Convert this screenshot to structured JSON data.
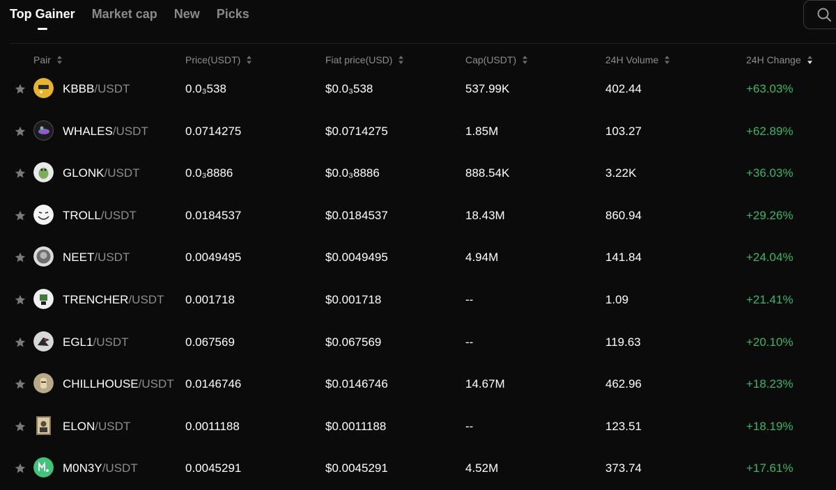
{
  "tabs": [
    {
      "label": "Top Gainer",
      "active": true
    },
    {
      "label": "Market cap",
      "active": false
    },
    {
      "label": "New",
      "active": false
    },
    {
      "label": "Picks",
      "active": false
    }
  ],
  "table": {
    "columns": [
      "Pair",
      "Price(USDT)",
      "Fiat price(USD)",
      "Cap(USDT)",
      "24H Volume",
      "24H Change"
    ],
    "sorted_column": "24H Change",
    "sort_direction": "desc",
    "positive_color": "#35b86a",
    "rows": [
      {
        "base": "KBBB",
        "quote": "/USDT",
        "price": "0.0₃538",
        "fiat": "$0.0₃538",
        "cap": "537.99K",
        "volume": "402.44",
        "change": "+63.03%",
        "icon": "kbbb-coin-icon"
      },
      {
        "base": "WHALES",
        "quote": "/USDT",
        "price": "0.0714275",
        "fiat": "$0.0714275",
        "cap": "1.85M",
        "volume": "103.27",
        "change": "+62.89%",
        "icon": "whales-coin-icon"
      },
      {
        "base": "GLONK",
        "quote": "/USDT",
        "price": "0.0₃8886",
        "fiat": "$0.0₃8886",
        "cap": "888.54K",
        "volume": "3.22K",
        "change": "+36.03%",
        "icon": "glonk-coin-icon"
      },
      {
        "base": "TROLL",
        "quote": "/USDT",
        "price": "0.0184537",
        "fiat": "$0.0184537",
        "cap": "18.43M",
        "volume": "860.94",
        "change": "+29.26%",
        "icon": "troll-coin-icon"
      },
      {
        "base": "NEET",
        "quote": "/USDT",
        "price": "0.0049495",
        "fiat": "$0.0049495",
        "cap": "4.94M",
        "volume": "141.84",
        "change": "+24.04%",
        "icon": "neet-coin-icon"
      },
      {
        "base": "TRENCHER",
        "quote": "/USDT",
        "price": "0.001718",
        "fiat": "$0.001718",
        "cap": "--",
        "volume": "1.09",
        "change": "+21.41%",
        "icon": "trencher-coin-icon"
      },
      {
        "base": "EGL1",
        "quote": "/USDT",
        "price": "0.067569",
        "fiat": "$0.067569",
        "cap": "--",
        "volume": "119.63",
        "change": "+20.10%",
        "icon": "egl1-coin-icon"
      },
      {
        "base": "CHILLHOUSE",
        "quote": "/USDT",
        "price": "0.0146746",
        "fiat": "$0.0146746",
        "cap": "14.67M",
        "volume": "462.96",
        "change": "+18.23%",
        "icon": "chillhouse-coin-icon"
      },
      {
        "base": "ELON",
        "quote": "/USDT",
        "price": "0.0011188",
        "fiat": "$0.0011188",
        "cap": "--",
        "volume": "123.51",
        "change": "+18.19%",
        "icon": "elon-coin-icon"
      },
      {
        "base": "M0N3Y",
        "quote": "/USDT",
        "price": "0.0045291",
        "fiat": "$0.0045291",
        "cap": "4.52M",
        "volume": "373.74",
        "change": "+17.61%",
        "icon": "m0n3y-coin-icon"
      }
    ]
  }
}
